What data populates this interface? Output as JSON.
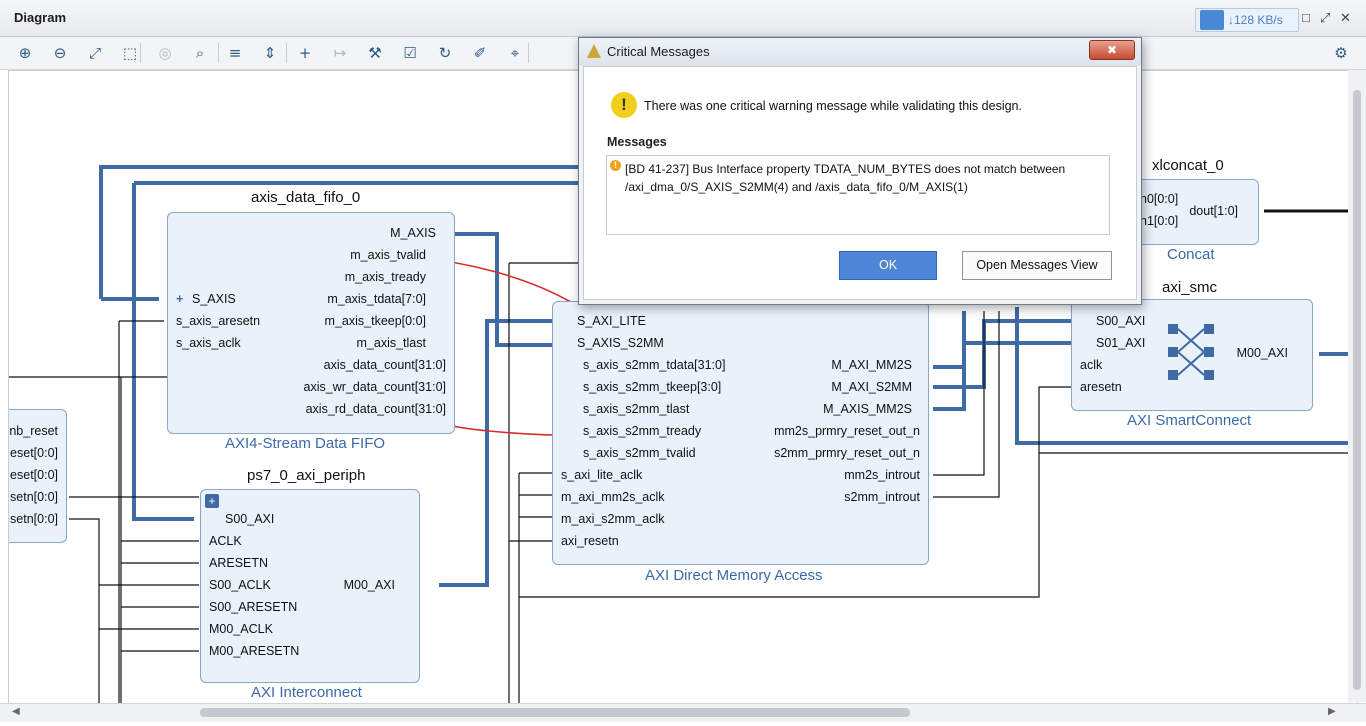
{
  "panel": {
    "title": "Diagram"
  },
  "netspeed": {
    "text": "↓128 KB/s"
  },
  "toolbar": {
    "buttons": [
      {
        "glyph": "⊕",
        "name": "zoom-in-icon"
      },
      {
        "glyph": "⊖",
        "name": "zoom-out-icon"
      },
      {
        "glyph": "⤢",
        "name": "zoom-fit-icon"
      },
      {
        "glyph": "⬚",
        "name": "zoom-area-icon"
      },
      {
        "glyph": "◎",
        "name": "center-icon"
      },
      {
        "glyph": "⌕",
        "name": "search-icon"
      },
      {
        "glyph": "≡",
        "name": "collapse-icon"
      },
      {
        "glyph": "⇕",
        "name": "expand-icon"
      },
      {
        "glyph": "+",
        "name": "add-ip-icon"
      },
      {
        "glyph": "↦",
        "name": "make-external-icon"
      },
      {
        "glyph": "⚒",
        "name": "properties-icon"
      },
      {
        "glyph": "☑",
        "name": "validate-icon"
      },
      {
        "glyph": "↻",
        "name": "regenerate-icon"
      },
      {
        "glyph": "✐",
        "name": "auto-connect-icon"
      },
      {
        "glyph": "⌖",
        "name": "debug-icon"
      }
    ],
    "settings_glyph": "⚙"
  },
  "blocks": {
    "fifo": {
      "name": "axis_data_fifo_0",
      "subtitle": "AXI4-Stream Data FIFO",
      "left_ports": [
        "S_AXIS",
        "s_axis_aresetn",
        "s_axis_aclk"
      ],
      "right_ports": [
        "M_AXIS",
        "m_axis_tvalid",
        "m_axis_tready",
        "m_axis_tdata[7:0]",
        "m_axis_tkeep[0:0]",
        "m_axis_tlast",
        "axis_data_count[31:0]",
        "axis_wr_data_count[31:0]",
        "axis_rd_data_count[31:0]"
      ]
    },
    "dma": {
      "left_ports": [
        "S_AXI_LITE",
        "S_AXIS_S2MM",
        "s_axis_s2mm_tdata[31:0]",
        "s_axis_s2mm_tkeep[3:0]",
        "s_axis_s2mm_tlast",
        "s_axis_s2mm_tready",
        "s_axis_s2mm_tvalid",
        "s_axi_lite_aclk",
        "m_axi_mm2s_aclk",
        "m_axi_s2mm_aclk",
        "axi_resetn"
      ],
      "right_ports": [
        "M_AXI_MM2S",
        "M_AXI_S2MM",
        "M_AXIS_MM2S",
        "mm2s_prmry_reset_out_n",
        "s2mm_prmry_reset_out_n",
        "mm2s_introut",
        "s2mm_introut"
      ],
      "subtitle": "AXI Direct Memory Access"
    },
    "periph": {
      "name": "ps7_0_axi_periph",
      "subtitle": "AXI Interconnect",
      "left_ports": [
        "S00_AXI",
        "ACLK",
        "ARESETN",
        "S00_ACLK",
        "S00_ARESETN",
        "M00_ACLK",
        "M00_ARESETN"
      ],
      "right_ports": [
        "M00_AXI"
      ]
    },
    "smc": {
      "name": "axi_smc",
      "subtitle": "AXI SmartConnect",
      "left_ports": [
        "S00_AXI",
        "S01_AXI",
        "aclk",
        "aresetn"
      ],
      "right_ports": [
        "M00_AXI"
      ]
    },
    "concat": {
      "name": "xlconcat_0",
      "subtitle": "Concat",
      "left_ports": [
        "In0[0:0]",
        "In1[0:0]"
      ],
      "left_ports_visible": [
        "n0[0:0]",
        "n1[0:0]"
      ],
      "right_ports": [
        "dout[1:0]"
      ]
    },
    "reset": {
      "ports": [
        "nb_reset",
        "eset[0:0]",
        "eset[0:0]",
        "setn[0:0]",
        "setn[0:0]"
      ]
    }
  },
  "dialog": {
    "title": "Critical Messages",
    "close_glyph": "✖",
    "message": "There was one critical warning message while validating this design.",
    "messages_label": "Messages",
    "items": [
      "[BD 41-237] Bus Interface property TDATA_NUM_BYTES does not match between /axi_dma_0/S_AXIS_S2MM(4) and /axis_data_fifo_0/M_AXIS(1)"
    ],
    "ok_label": "OK",
    "open_view_label": "Open Messages View"
  },
  "colors": {
    "bus": "#3f6aa3",
    "annotation": "#d92b2b",
    "ok_button": "#4f86d6",
    "block_fill": "#e9f1fb"
  }
}
